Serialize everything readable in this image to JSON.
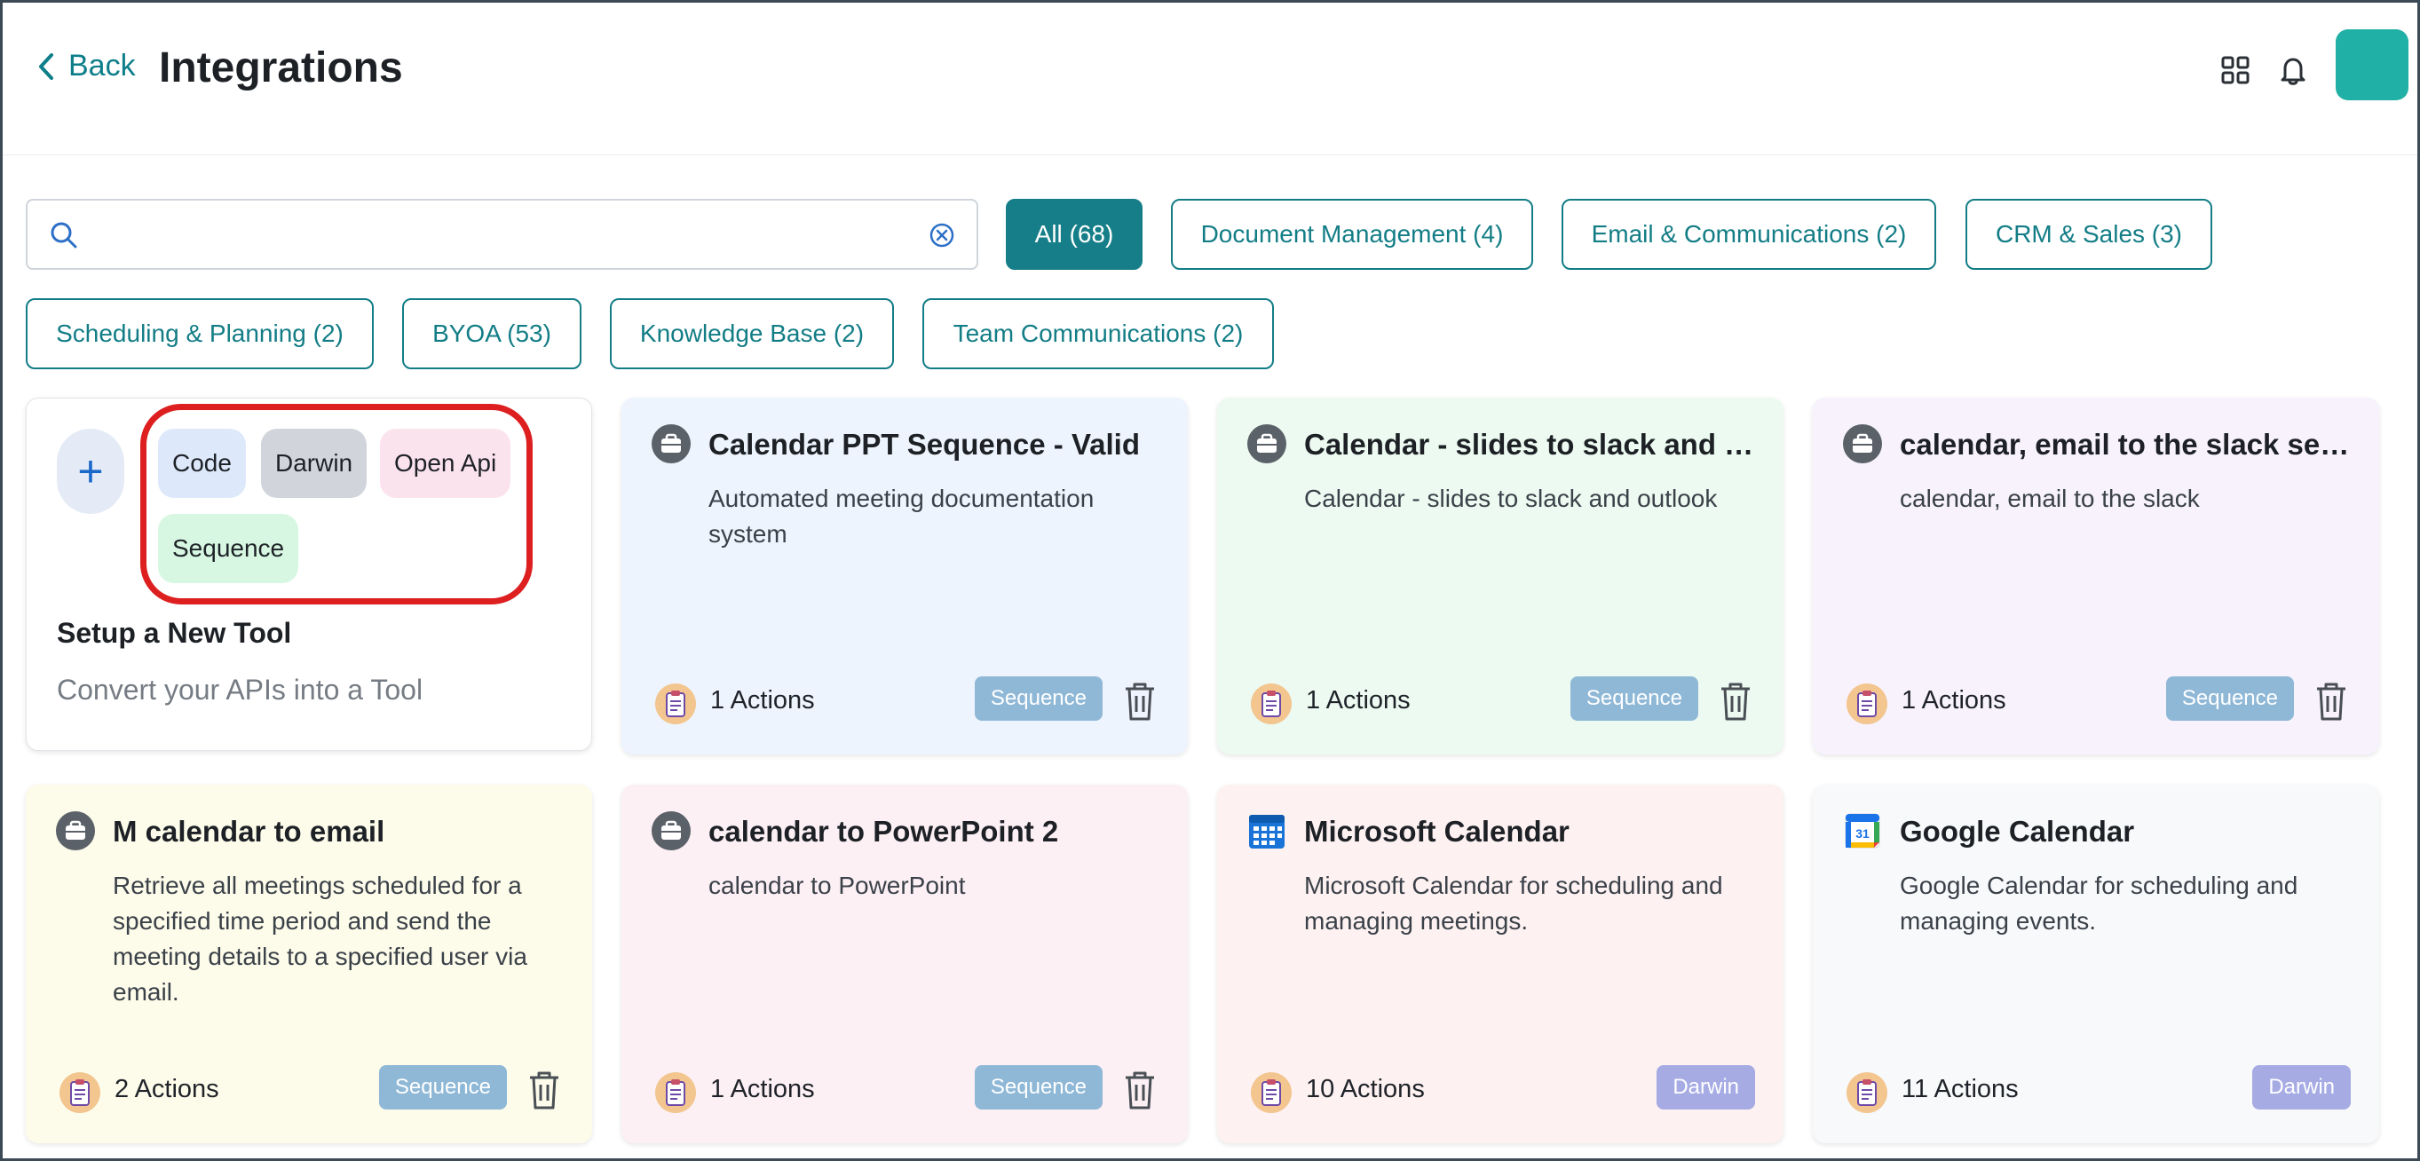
{
  "header": {
    "back_label": "Back",
    "title": "Integrations",
    "icons": [
      "grid-icon",
      "bell-icon"
    ]
  },
  "search": {
    "value": "",
    "placeholder": ""
  },
  "filters": [
    {
      "label": "All (68)",
      "active": true
    },
    {
      "label": "Document Management (4)",
      "active": false
    },
    {
      "label": "Email & Communications (2)",
      "active": false
    },
    {
      "label": "CRM & Sales (3)",
      "active": false
    },
    {
      "label": "Scheduling & Planning (2)",
      "active": false
    },
    {
      "label": "BYOA (53)",
      "active": false
    },
    {
      "label": "Knowledge Base (2)",
      "active": false
    },
    {
      "label": "Team Communications (2)",
      "active": false
    }
  ],
  "setup_card": {
    "types": [
      "Code",
      "Darwin",
      "Open Api",
      "Sequence"
    ],
    "title": "Setup a New Tool",
    "subtitle": "Convert your APIs into a Tool",
    "highlight_color": "#dd1f20"
  },
  "cards": [
    {
      "title": "Calendar PPT Sequence - Valid",
      "description": "Automated meeting documentation system",
      "actions": "1 Actions",
      "badge": "Sequence",
      "icon": "briefcase-icon",
      "bg": "#eef4fd"
    },
    {
      "title": "Calendar - slides to slack and outlook",
      "description": "Calendar - slides to slack and outlook",
      "actions": "1 Actions",
      "badge": "Sequence",
      "icon": "briefcase-icon",
      "bg": "#edfaf1"
    },
    {
      "title": "calendar, email to the slack sequence",
      "description": "calendar, email to the slack",
      "actions": "1 Actions",
      "badge": "Sequence",
      "icon": "briefcase-icon",
      "bg": "#f7f2fc"
    },
    {
      "title": "M calendar to email",
      "description": "Retrieve all meetings scheduled for a specified time period and send the meeting details to a specified user via email.",
      "actions": "2 Actions",
      "badge": "Sequence",
      "icon": "briefcase-icon",
      "bg": "#fdfcea"
    },
    {
      "title": "calendar to PowerPoint 2",
      "description": "calendar to PowerPoint",
      "actions": "1 Actions",
      "badge": "Sequence",
      "icon": "briefcase-icon",
      "bg": "#fcf0f4"
    },
    {
      "title": "Microsoft Calendar",
      "description": "Microsoft Calendar for scheduling and managing meetings.",
      "actions": "10 Actions",
      "badge": "Darwin",
      "icon": "microsoft-calendar-icon",
      "bg": "#fdf1f1"
    },
    {
      "title": "Google Calendar",
      "description": "Google Calendar for scheduling and managing events.",
      "actions": "11 Actions",
      "badge": "Darwin",
      "icon": "google-calendar-icon",
      "bg": "#f8f9fb"
    }
  ],
  "colors": {
    "accent": "#137d86",
    "sequence_badge": "#8fb8d7",
    "darwin_badge": "#a6abe4"
  }
}
